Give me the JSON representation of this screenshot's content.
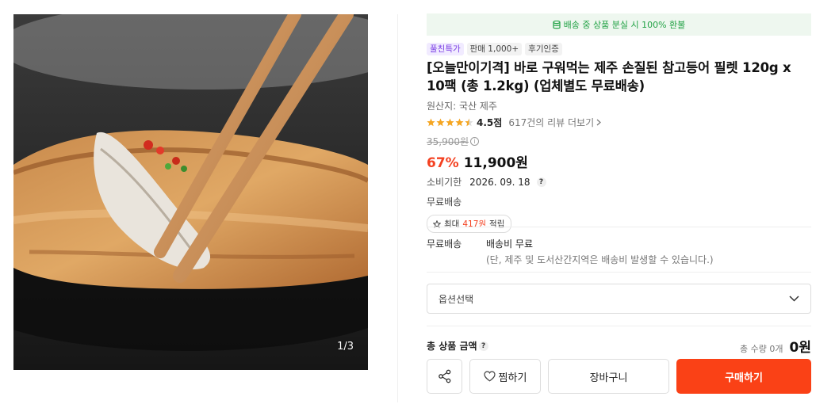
{
  "gallery": {
    "counter": "1/3"
  },
  "notice": {
    "text": "배송 중 상품 분실 시 100% 환불",
    "icon": "database-icon"
  },
  "badges": [
    "풀친특가",
    "판매 1,000+",
    "후기인증"
  ],
  "product": {
    "title": "[오늘만이기격] 바로 구워먹는 제주 손질된 참고등어 필렛 120g x 10팩 (총 1.2kg) (업체별도 무료배송)",
    "origin": "원산지: 국산 제주",
    "rating": "4.5점",
    "rating_value": 4.5,
    "reviews": "617건의 리뷰 더보기",
    "original_price": "35,900원",
    "discount": "67%",
    "price": "11,900원",
    "expiry_label": "소비기한",
    "expiry_value": "2026. 09. 18",
    "shipping_free": "무료배송",
    "points_prefix": "최대",
    "points_amount": "417원",
    "points_suffix": "적립"
  },
  "shipping": {
    "label": "무료배송",
    "fee": "배송비 무료",
    "note": "(단, 제주 및 도서산간지역은 배송비 발생할 수 있습니다.)"
  },
  "option": {
    "placeholder": "옵션선택"
  },
  "total": {
    "label": "총 상품 금액",
    "qty": "총 수량 0개",
    "price": "0원"
  },
  "actions": {
    "wish": "찜하기",
    "cart": "장바구니",
    "buy": "구매하기"
  },
  "colors": {
    "accent": "#fa4116",
    "notice_green": "#22a245",
    "badge_purple": "#7b3fe4",
    "star": "#f5a623"
  }
}
